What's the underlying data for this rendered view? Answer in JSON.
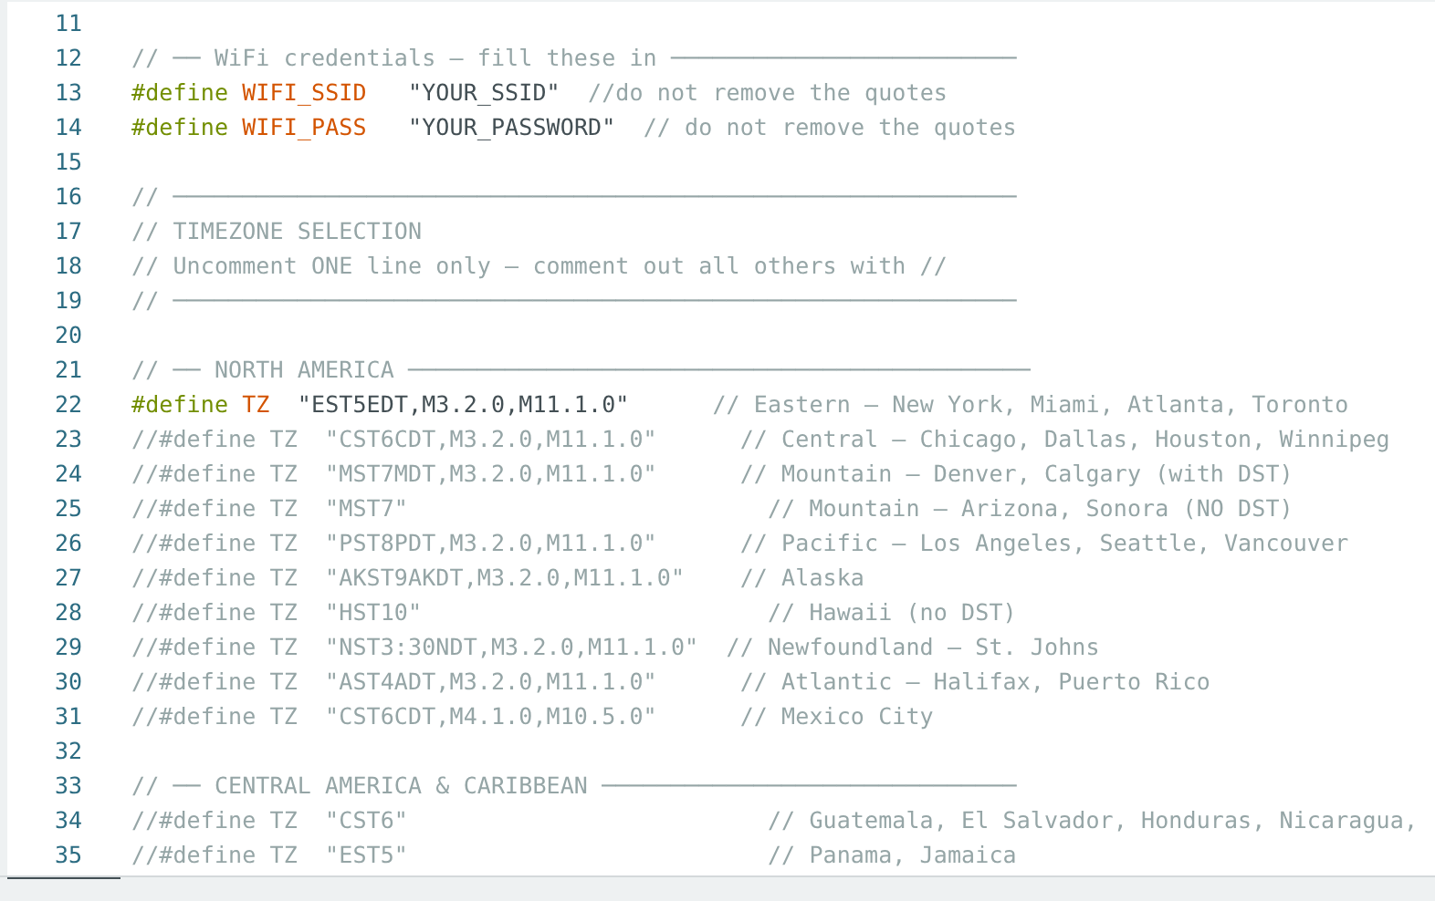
{
  "editor": {
    "lines": [
      {
        "number": "11"
      },
      {
        "number": "12",
        "tokens": [
          {
            "kind": "comment",
            "text": "// ── WiFi credentials — fill these in ─────────────────────────"
          }
        ]
      },
      {
        "number": "13",
        "tokens": [
          {
            "kind": "keyword",
            "text": "#define "
          },
          {
            "kind": "macro",
            "text": "WIFI_SSID   "
          },
          {
            "kind": "string",
            "text": "\"YOUR_SSID\"  "
          },
          {
            "kind": "comment",
            "text": "//do not remove the quotes"
          }
        ]
      },
      {
        "number": "14",
        "tokens": [
          {
            "kind": "keyword",
            "text": "#define "
          },
          {
            "kind": "macro",
            "text": "WIFI_PASS   "
          },
          {
            "kind": "string",
            "text": "\"YOUR_PASSWORD\"  "
          },
          {
            "kind": "comment",
            "text": "// do not remove the quotes"
          }
        ]
      },
      {
        "number": "15"
      },
      {
        "number": "16",
        "tokens": [
          {
            "kind": "comment",
            "text": "// ─────────────────────────────────────────────────────────────"
          }
        ]
      },
      {
        "number": "17",
        "tokens": [
          {
            "kind": "comment",
            "text": "// TIMEZONE SELECTION"
          }
        ]
      },
      {
        "number": "18",
        "tokens": [
          {
            "kind": "comment",
            "text": "// Uncomment ONE line only — comment out all others with //"
          }
        ]
      },
      {
        "number": "19",
        "tokens": [
          {
            "kind": "comment",
            "text": "// ─────────────────────────────────────────────────────────────"
          }
        ]
      },
      {
        "number": "20"
      },
      {
        "number": "21",
        "tokens": [
          {
            "kind": "comment",
            "text": "// ── NORTH AMERICA ─────────────────────────────────────────────"
          }
        ]
      },
      {
        "number": "22",
        "tokens": [
          {
            "kind": "keyword",
            "text": "#define "
          },
          {
            "kind": "macro",
            "text": "TZ  "
          },
          {
            "kind": "string",
            "text": "\"EST5EDT,M3.2.0,M11.1.0\"      "
          },
          {
            "kind": "comment",
            "text": "// Eastern — New York, Miami, Atlanta, Toronto"
          }
        ]
      },
      {
        "number": "23",
        "tokens": [
          {
            "kind": "comment",
            "text": "//#define TZ  \"CST6CDT,M3.2.0,M11.1.0\"      // Central — Chicago, Dallas, Houston, Winnipeg"
          }
        ]
      },
      {
        "number": "24",
        "tokens": [
          {
            "kind": "comment",
            "text": "//#define TZ  \"MST7MDT,M3.2.0,M11.1.0\"      // Mountain — Denver, Calgary (with DST)"
          }
        ]
      },
      {
        "number": "25",
        "tokens": [
          {
            "kind": "comment",
            "text": "//#define TZ  \"MST7\"                          // Mountain — Arizona, Sonora (NO DST)"
          }
        ]
      },
      {
        "number": "26",
        "tokens": [
          {
            "kind": "comment",
            "text": "//#define TZ  \"PST8PDT,M3.2.0,M11.1.0\"      // Pacific — Los Angeles, Seattle, Vancouver"
          }
        ]
      },
      {
        "number": "27",
        "tokens": [
          {
            "kind": "comment",
            "text": "//#define TZ  \"AKST9AKDT,M3.2.0,M11.1.0\"    // Alaska"
          }
        ]
      },
      {
        "number": "28",
        "tokens": [
          {
            "kind": "comment",
            "text": "//#define TZ  \"HST10\"                         // Hawaii (no DST)"
          }
        ]
      },
      {
        "number": "29",
        "tokens": [
          {
            "kind": "comment",
            "text": "//#define TZ  \"NST3:30NDT,M3.2.0,M11.1.0\"  // Newfoundland — St. Johns"
          }
        ]
      },
      {
        "number": "30",
        "tokens": [
          {
            "kind": "comment",
            "text": "//#define TZ  \"AST4ADT,M3.2.0,M11.1.0\"      // Atlantic — Halifax, Puerto Rico"
          }
        ]
      },
      {
        "number": "31",
        "tokens": [
          {
            "kind": "comment",
            "text": "//#define TZ  \"CST6CDT,M4.1.0,M10.5.0\"      // Mexico City"
          }
        ]
      },
      {
        "number": "32"
      },
      {
        "number": "33",
        "tokens": [
          {
            "kind": "comment",
            "text": "// ── CENTRAL AMERICA & CARIBBEAN ──────────────────────────────"
          }
        ]
      },
      {
        "number": "34",
        "tokens": [
          {
            "kind": "comment",
            "text": "//#define TZ  \"CST6\"                          // Guatemala, El Salvador, Honduras, Nicaragua,"
          }
        ]
      },
      {
        "number": "35",
        "tokens": [
          {
            "kind": "comment",
            "text": "//#define TZ  \"EST5\"                          // Panama, Jamaica"
          }
        ]
      }
    ]
  }
}
